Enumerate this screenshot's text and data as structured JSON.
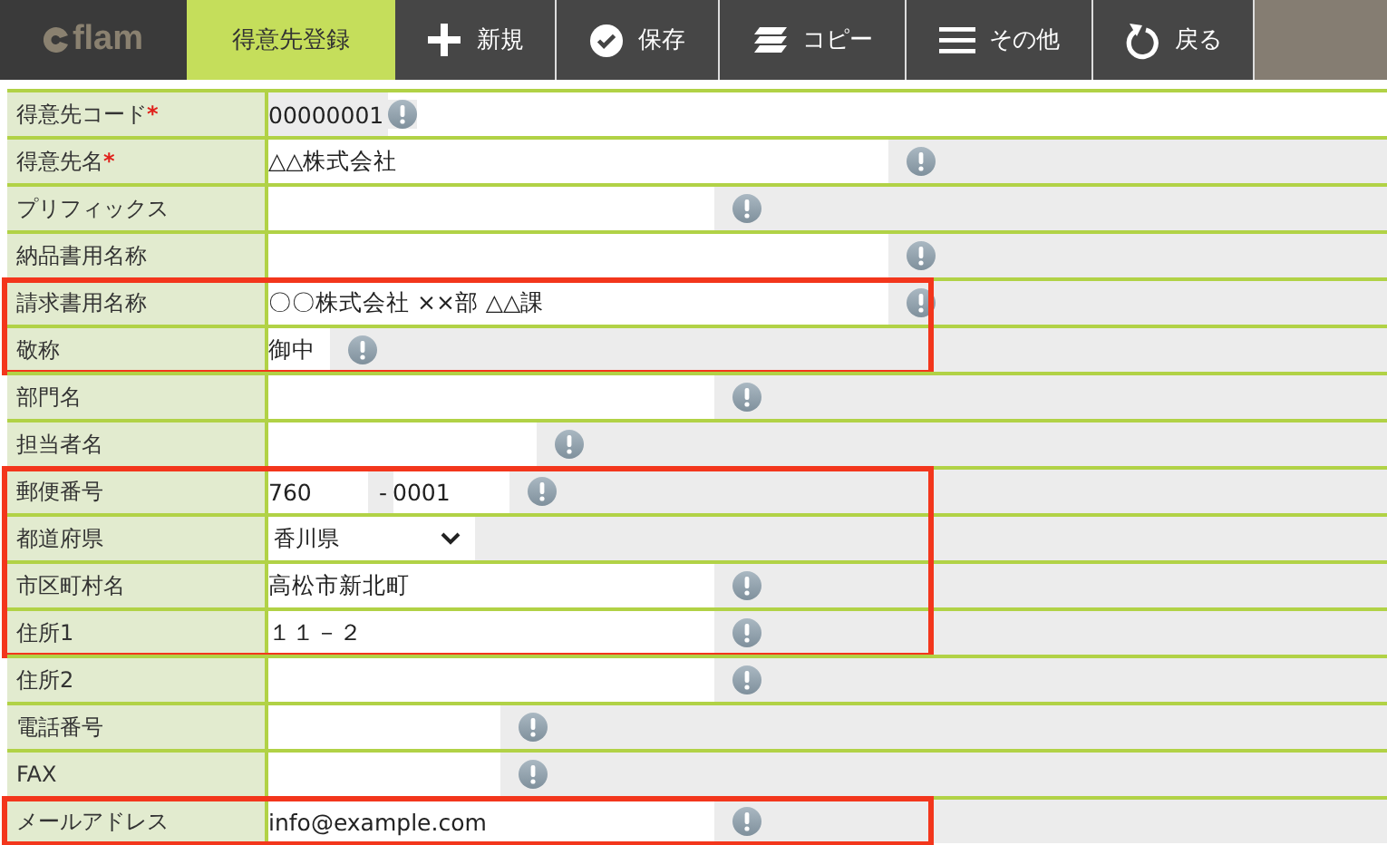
{
  "logo": {
    "text": "flam"
  },
  "toolbar": [
    {
      "label": "得意先登録",
      "kind": "tab",
      "selected": true
    },
    {
      "label": "新規",
      "kind": "plus",
      "selected": false
    },
    {
      "label": "保存",
      "kind": "check",
      "selected": false
    },
    {
      "label": "コピー",
      "kind": "copy",
      "selected": false
    },
    {
      "label": "その他",
      "kind": "menu",
      "selected": false
    },
    {
      "label": "戻る",
      "kind": "back",
      "selected": false
    }
  ],
  "sections": [
    {
      "rows": [
        {
          "label": "得意先コード",
          "required_mark": "*",
          "kind": "readonly",
          "value": "00000001"
        },
        {
          "label": "得意先名",
          "required_mark": "*",
          "kind": "text",
          "value": "△△株式会社"
        },
        {
          "label": "プリフィックス",
          "kind": "text"
        },
        {
          "label": "納品書用名称",
          "kind": "text"
        }
      ]
    },
    {
      "highlighted": true,
      "rows": [
        {
          "label": "請求書用名称",
          "kind": "text",
          "value": "〇〇株式会社 ××部 △△課"
        },
        {
          "label": "敬称",
          "kind": "text",
          "value": "御中"
        }
      ]
    },
    {
      "rows": [
        {
          "label": "部門名",
          "kind": "text"
        },
        {
          "label": "担当者名",
          "kind": "text"
        }
      ]
    },
    {
      "highlighted": true,
      "rows": [
        {
          "label": "郵便番号",
          "kind": "postal",
          "value": "760",
          "value2": "0001",
          "separator": "-"
        },
        {
          "label": "都道府県",
          "kind": "select",
          "value": "香川県"
        },
        {
          "label": "市区町村名",
          "kind": "text",
          "value": "高松市新北町"
        },
        {
          "label": "住所1",
          "kind": "text",
          "value": "１１－２"
        }
      ]
    },
    {
      "rows": [
        {
          "label": "住所2",
          "kind": "text"
        },
        {
          "label": "電話番号",
          "kind": "text"
        },
        {
          "label": "FAX",
          "kind": "text"
        }
      ]
    },
    {
      "highlighted": true,
      "rows": [
        {
          "label": "メールアドレス",
          "kind": "text",
          "value": "info@example.com"
        }
      ]
    }
  ]
}
